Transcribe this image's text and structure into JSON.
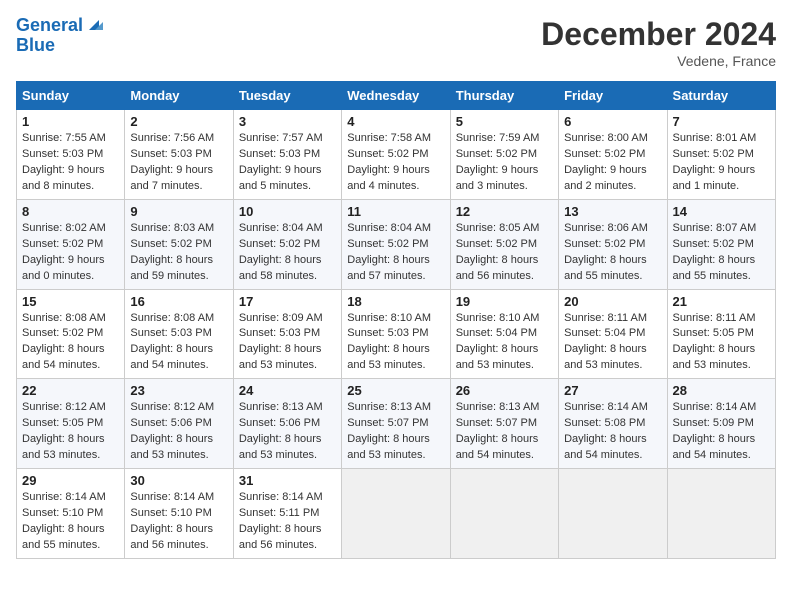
{
  "header": {
    "logo_line1": "General",
    "logo_line2": "Blue",
    "month_title": "December 2024",
    "location": "Vedene, France"
  },
  "weekdays": [
    "Sunday",
    "Monday",
    "Tuesday",
    "Wednesday",
    "Thursday",
    "Friday",
    "Saturday"
  ],
  "weeks": [
    [
      {
        "day": "1",
        "sunrise": "7:55 AM",
        "sunset": "5:03 PM",
        "daylight": "9 hours and 8 minutes."
      },
      {
        "day": "2",
        "sunrise": "7:56 AM",
        "sunset": "5:03 PM",
        "daylight": "9 hours and 7 minutes."
      },
      {
        "day": "3",
        "sunrise": "7:57 AM",
        "sunset": "5:03 PM",
        "daylight": "9 hours and 5 minutes."
      },
      {
        "day": "4",
        "sunrise": "7:58 AM",
        "sunset": "5:02 PM",
        "daylight": "9 hours and 4 minutes."
      },
      {
        "day": "5",
        "sunrise": "7:59 AM",
        "sunset": "5:02 PM",
        "daylight": "9 hours and 3 minutes."
      },
      {
        "day": "6",
        "sunrise": "8:00 AM",
        "sunset": "5:02 PM",
        "daylight": "9 hours and 2 minutes."
      },
      {
        "day": "7",
        "sunrise": "8:01 AM",
        "sunset": "5:02 PM",
        "daylight": "9 hours and 1 minute."
      }
    ],
    [
      {
        "day": "8",
        "sunrise": "8:02 AM",
        "sunset": "5:02 PM",
        "daylight": "9 hours and 0 minutes."
      },
      {
        "day": "9",
        "sunrise": "8:03 AM",
        "sunset": "5:02 PM",
        "daylight": "8 hours and 59 minutes."
      },
      {
        "day": "10",
        "sunrise": "8:04 AM",
        "sunset": "5:02 PM",
        "daylight": "8 hours and 58 minutes."
      },
      {
        "day": "11",
        "sunrise": "8:04 AM",
        "sunset": "5:02 PM",
        "daylight": "8 hours and 57 minutes."
      },
      {
        "day": "12",
        "sunrise": "8:05 AM",
        "sunset": "5:02 PM",
        "daylight": "8 hours and 56 minutes."
      },
      {
        "day": "13",
        "sunrise": "8:06 AM",
        "sunset": "5:02 PM",
        "daylight": "8 hours and 55 minutes."
      },
      {
        "day": "14",
        "sunrise": "8:07 AM",
        "sunset": "5:02 PM",
        "daylight": "8 hours and 55 minutes."
      }
    ],
    [
      {
        "day": "15",
        "sunrise": "8:08 AM",
        "sunset": "5:02 PM",
        "daylight": "8 hours and 54 minutes."
      },
      {
        "day": "16",
        "sunrise": "8:08 AM",
        "sunset": "5:03 PM",
        "daylight": "8 hours and 54 minutes."
      },
      {
        "day": "17",
        "sunrise": "8:09 AM",
        "sunset": "5:03 PM",
        "daylight": "8 hours and 53 minutes."
      },
      {
        "day": "18",
        "sunrise": "8:10 AM",
        "sunset": "5:03 PM",
        "daylight": "8 hours and 53 minutes."
      },
      {
        "day": "19",
        "sunrise": "8:10 AM",
        "sunset": "5:04 PM",
        "daylight": "8 hours and 53 minutes."
      },
      {
        "day": "20",
        "sunrise": "8:11 AM",
        "sunset": "5:04 PM",
        "daylight": "8 hours and 53 minutes."
      },
      {
        "day": "21",
        "sunrise": "8:11 AM",
        "sunset": "5:05 PM",
        "daylight": "8 hours and 53 minutes."
      }
    ],
    [
      {
        "day": "22",
        "sunrise": "8:12 AM",
        "sunset": "5:05 PM",
        "daylight": "8 hours and 53 minutes."
      },
      {
        "day": "23",
        "sunrise": "8:12 AM",
        "sunset": "5:06 PM",
        "daylight": "8 hours and 53 minutes."
      },
      {
        "day": "24",
        "sunrise": "8:13 AM",
        "sunset": "5:06 PM",
        "daylight": "8 hours and 53 minutes."
      },
      {
        "day": "25",
        "sunrise": "8:13 AM",
        "sunset": "5:07 PM",
        "daylight": "8 hours and 53 minutes."
      },
      {
        "day": "26",
        "sunrise": "8:13 AM",
        "sunset": "5:07 PM",
        "daylight": "8 hours and 54 minutes."
      },
      {
        "day": "27",
        "sunrise": "8:14 AM",
        "sunset": "5:08 PM",
        "daylight": "8 hours and 54 minutes."
      },
      {
        "day": "28",
        "sunrise": "8:14 AM",
        "sunset": "5:09 PM",
        "daylight": "8 hours and 54 minutes."
      }
    ],
    [
      {
        "day": "29",
        "sunrise": "8:14 AM",
        "sunset": "5:10 PM",
        "daylight": "8 hours and 55 minutes."
      },
      {
        "day": "30",
        "sunrise": "8:14 AM",
        "sunset": "5:10 PM",
        "daylight": "8 hours and 56 minutes."
      },
      {
        "day": "31",
        "sunrise": "8:14 AM",
        "sunset": "5:11 PM",
        "daylight": "8 hours and 56 minutes."
      },
      null,
      null,
      null,
      null
    ]
  ],
  "labels": {
    "sunrise": "Sunrise:",
    "sunset": "Sunset:",
    "daylight": "Daylight:"
  }
}
